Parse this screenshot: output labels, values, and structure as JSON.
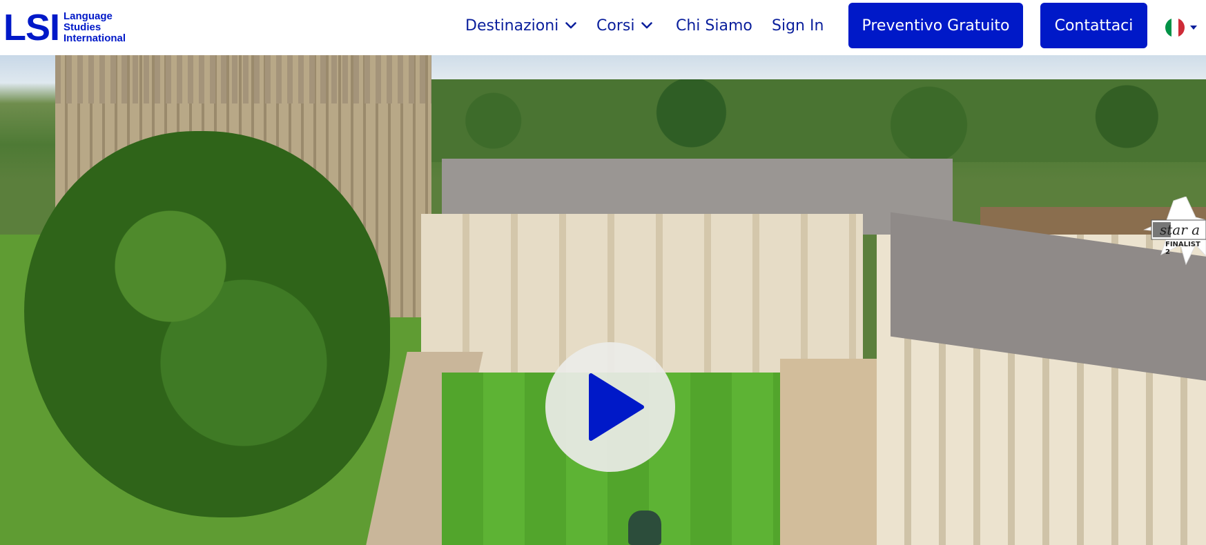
{
  "header": {
    "logo": {
      "mark": "LSI",
      "line1": "Language",
      "line2": "Studies",
      "line3": "International",
      "color": "#0019c8"
    },
    "nav": {
      "destinations": "Destinazioni",
      "courses": "Corsi",
      "about": "Chi Siamo",
      "sign_in": "Sign In"
    },
    "buttons": {
      "quote": "Preventivo Gratuito",
      "contact": "Contattaci"
    },
    "language": {
      "icon": "italian-flag-icon",
      "caret_icon": "caret-down-icon"
    },
    "colors": {
      "brand": "#0019c8",
      "nav_text": "#0a1f9c"
    }
  },
  "hero": {
    "image": "aerial-view-cambridge-colleges",
    "play_icon": "play-icon",
    "badge": {
      "icon": "star-award-icon",
      "label": "star a",
      "sub": "FINALIST 2"
    }
  }
}
